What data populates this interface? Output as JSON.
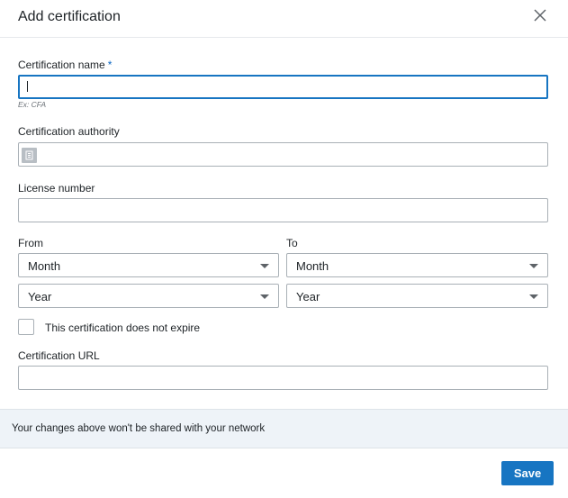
{
  "dialog": {
    "title": "Add certification",
    "close_icon": "close-icon"
  },
  "fields": {
    "certification_name": {
      "label": "Certification name",
      "required_marker": "*",
      "value": "",
      "hint": "Ex: CFA"
    },
    "certification_authority": {
      "label": "Certification authority",
      "value": "",
      "icon": "company-icon"
    },
    "license_number": {
      "label": "License number",
      "value": ""
    },
    "from": {
      "label": "From",
      "month": "Month",
      "year": "Year"
    },
    "to": {
      "label": "To",
      "month": "Month",
      "year": "Year"
    },
    "no_expire": {
      "label": "This certification does not expire",
      "checked": false
    },
    "certification_url": {
      "label": "Certification URL",
      "value": ""
    }
  },
  "notice": {
    "text": "Your changes above won't be shared with your network"
  },
  "footer": {
    "save_label": "Save"
  },
  "colors": {
    "accent": "#1775c2",
    "notice_bg": "#eef3f8"
  }
}
